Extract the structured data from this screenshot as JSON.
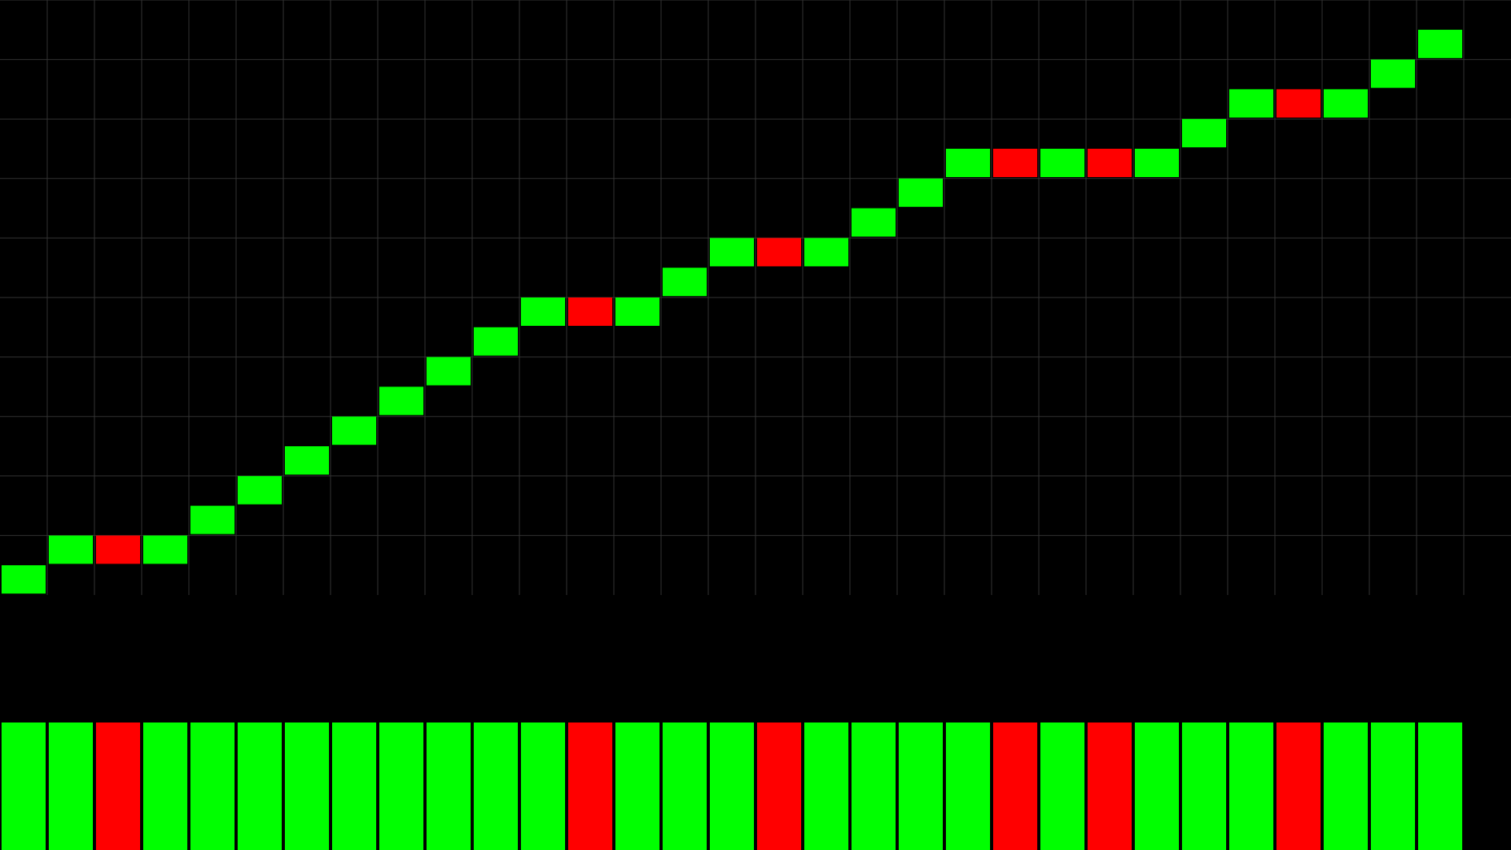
{
  "chart_data": {
    "type": "bar",
    "description_free": true,
    "colors": {
      "background": "#000000",
      "grid": "#333333",
      "up": "#00ff00",
      "down": "#ff0000"
    },
    "grid": true,
    "price_ladder": {
      "steps": [
        1,
        2,
        2,
        2,
        3,
        4,
        5,
        6,
        7,
        8,
        9,
        10,
        10,
        10,
        11,
        12,
        12,
        12,
        13,
        14,
        15,
        15,
        15,
        15,
        15,
        16,
        17,
        17,
        17,
        18,
        19
      ],
      "direction": [
        "up",
        "up",
        "down",
        "up",
        "up",
        "up",
        "up",
        "up",
        "up",
        "up",
        "up",
        "up",
        "down",
        "up",
        "up",
        "up",
        "down",
        "up",
        "up",
        "up",
        "up",
        "down",
        "up",
        "down",
        "up",
        "up",
        "up",
        "down",
        "up",
        "up",
        "up"
      ],
      "ylim": [
        0,
        20
      ]
    },
    "volume_bars": {
      "direction": [
        "up",
        "up",
        "down",
        "up",
        "up",
        "up",
        "up",
        "up",
        "up",
        "up",
        "up",
        "up",
        "down",
        "up",
        "up",
        "up",
        "down",
        "up",
        "up",
        "up",
        "up",
        "down",
        "up",
        "down",
        "up",
        "up",
        "up",
        "down",
        "up",
        "up",
        "up"
      ]
    }
  }
}
